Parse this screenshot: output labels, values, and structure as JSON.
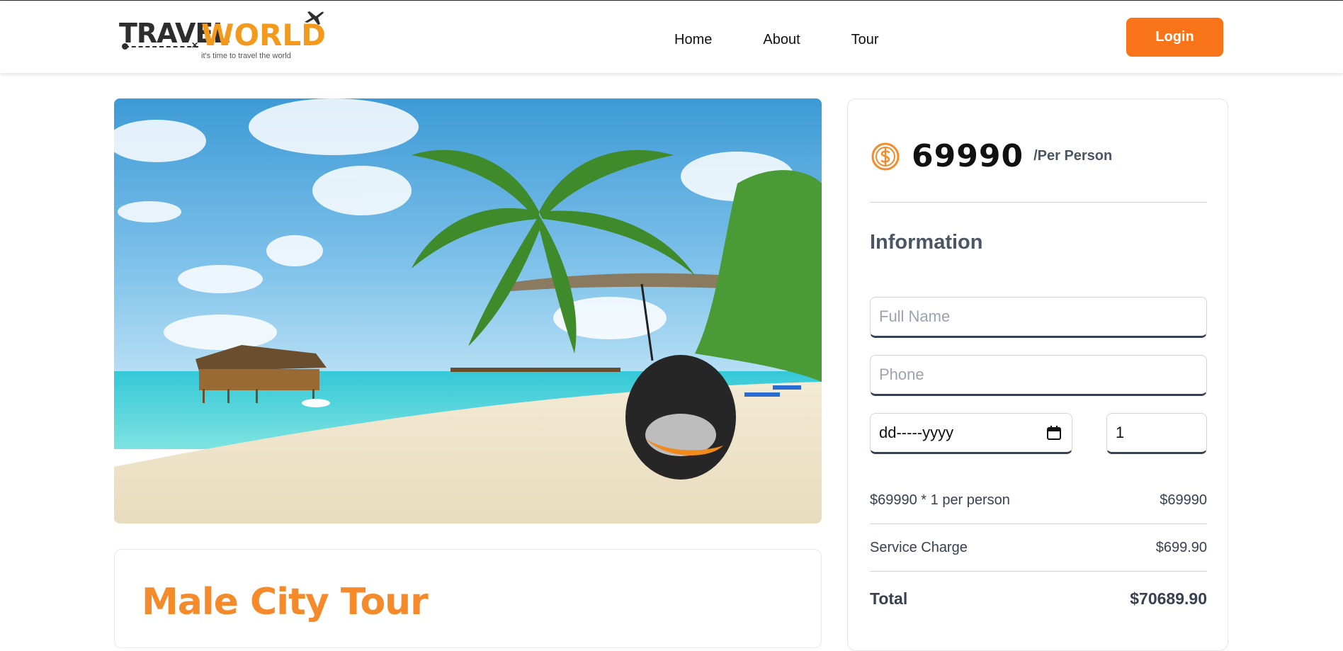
{
  "header": {
    "logo": {
      "part1": "TRAVEL",
      "part2": "WORLD",
      "tagline": "it's time to travel the world"
    },
    "nav": [
      {
        "label": "Home"
      },
      {
        "label": "About"
      },
      {
        "label": "Tour"
      }
    ],
    "login_label": "Login"
  },
  "tour": {
    "title": "Male City Tour"
  },
  "booking": {
    "price": "69990",
    "per_label": "/Per Person",
    "info_heading": "Information",
    "full_name_placeholder": "Full Name",
    "phone_placeholder": "Phone",
    "date_value": "dd-----yyyy",
    "guests_value": "1",
    "line_base_label": "$69990 * 1 per person",
    "line_base_value": "$69990",
    "service_label": "Service Charge",
    "service_value": "$699.90",
    "total_label": "Total",
    "total_value": "$70689.90"
  },
  "colors": {
    "accent": "#f97418",
    "logo_orange": "#f39a1c",
    "title_orange": "#f58a2a"
  },
  "icons": [
    "airplane-icon",
    "dollar-coin-icon",
    "calendar-icon"
  ]
}
